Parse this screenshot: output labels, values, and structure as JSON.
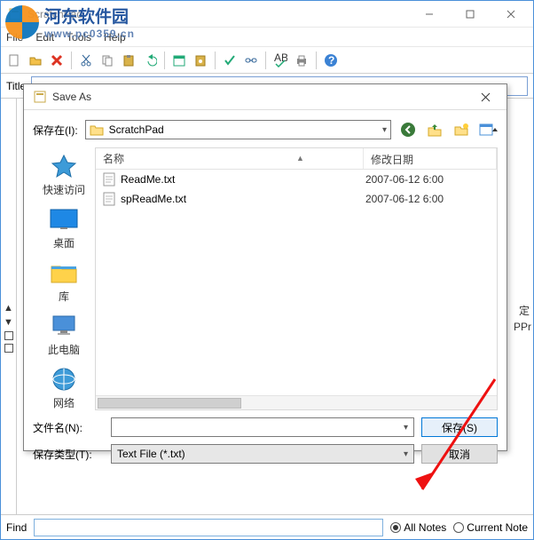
{
  "watermark": {
    "line1": "河东软件园",
    "line2": "www.pc0359.cn"
  },
  "main": {
    "title": "ScratchPad",
    "menu": {
      "file": "File",
      "edit": "Edit",
      "tools": "Tools",
      "help": "Help"
    },
    "title_label": "Title",
    "find_label": "Find",
    "filter": {
      "all": "All Notes",
      "current": "Current Note"
    },
    "side_symbols": {
      "up": "▲",
      "dn": "▼"
    },
    "right_snippet1": "定",
    "right_snippet2": "PPr"
  },
  "toolbar_icons": [
    "new",
    "open",
    "delete",
    "cut",
    "copy",
    "paste",
    "undo",
    "date",
    "attach",
    "bold",
    "spell",
    "print",
    "help"
  ],
  "dialog": {
    "title": "Save As",
    "location_label": "保存在(I):",
    "location_value": "ScratchPad",
    "columns": {
      "name": "名称",
      "date": "修改日期"
    },
    "files": [
      {
        "name": "ReadMe.txt",
        "date": "2007-06-12 6:00"
      },
      {
        "name": "spReadMe.txt",
        "date": "2007-06-12 6:00"
      }
    ],
    "filename_label": "文件名(N):",
    "filename_value": "",
    "filetype_label": "保存类型(T):",
    "filetype_value": "Text File (*.txt)",
    "save_btn": "保存(S)",
    "cancel_btn": "取消",
    "places": {
      "quick": "快速访问",
      "desktop": "桌面",
      "libs": "库",
      "thispc": "此电脑",
      "network": "网络"
    }
  }
}
